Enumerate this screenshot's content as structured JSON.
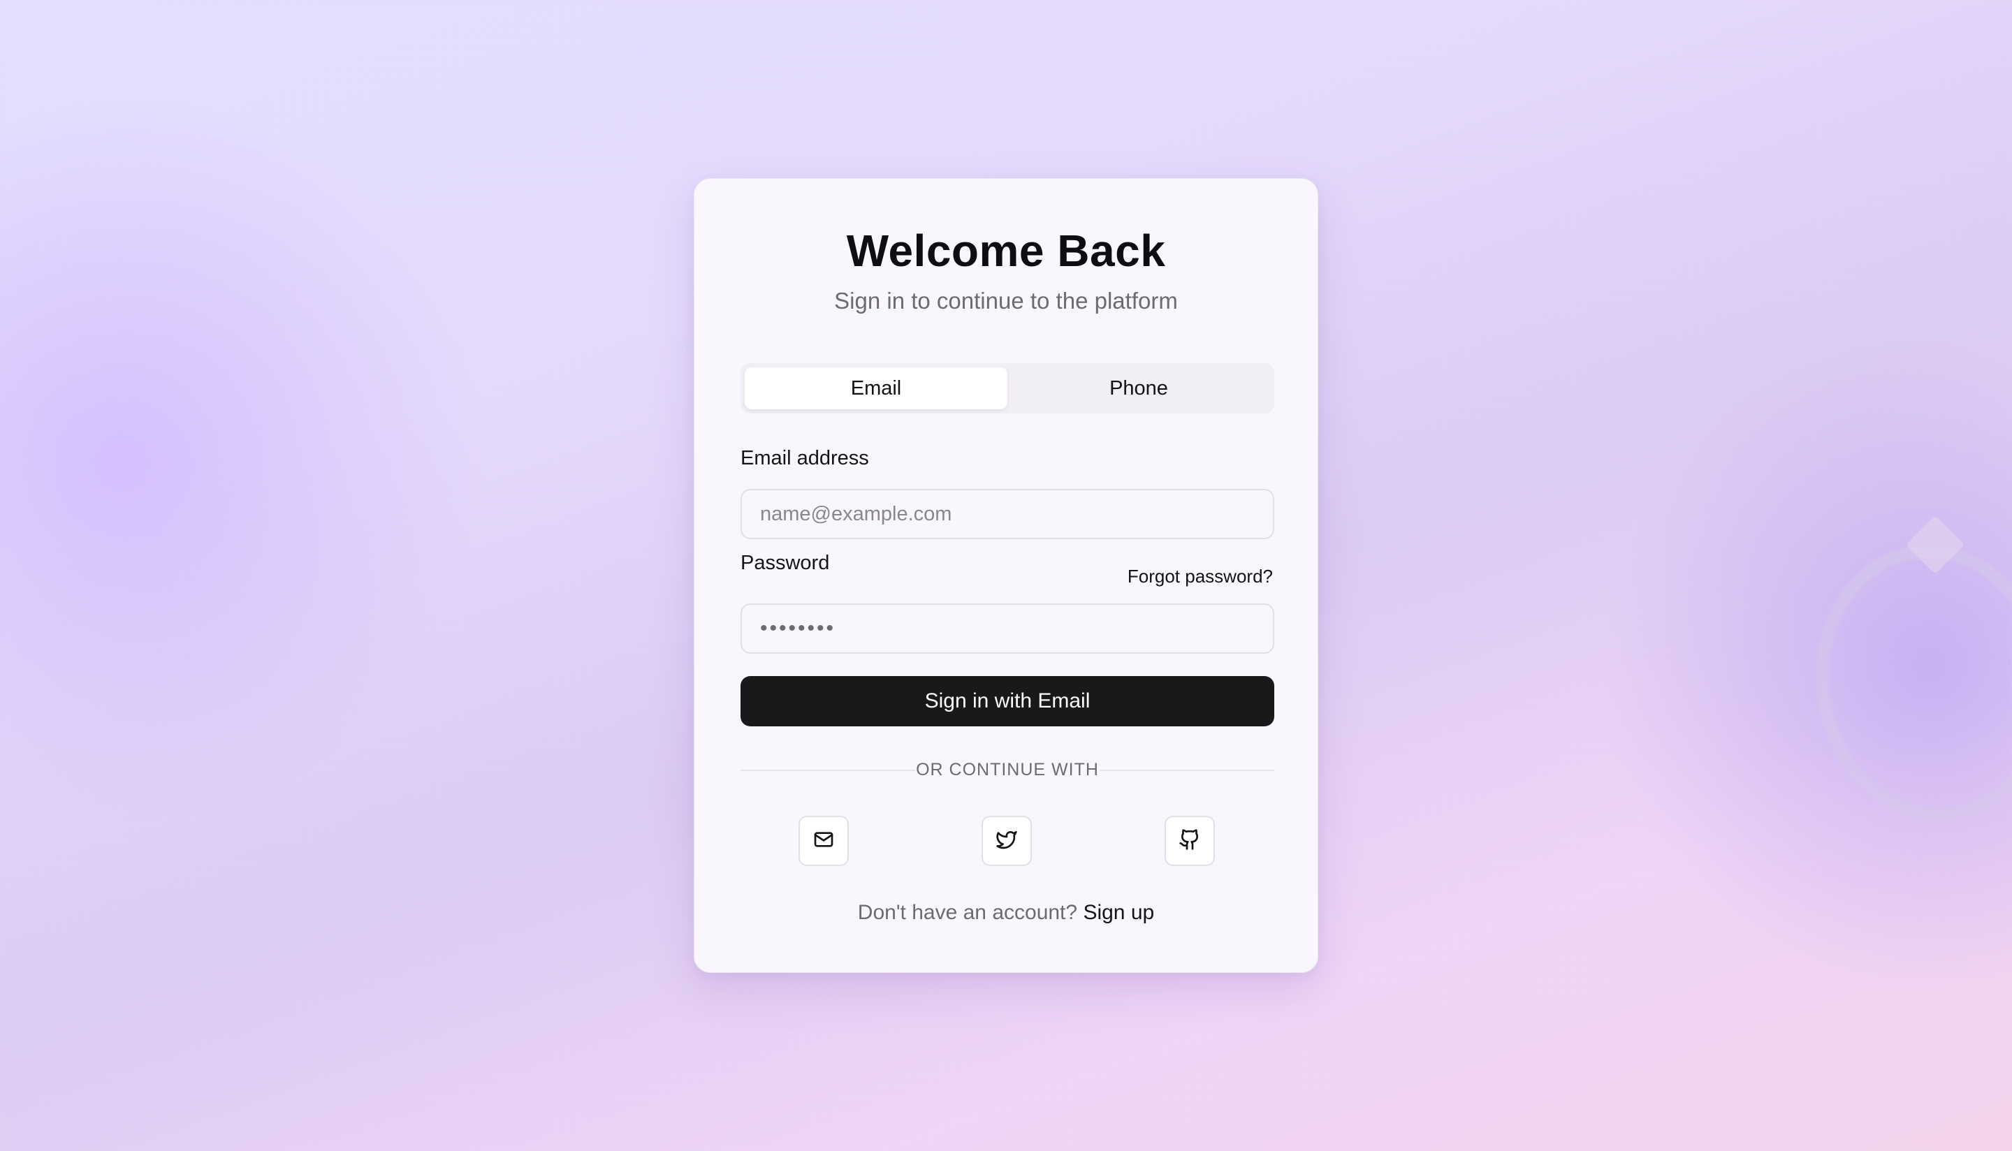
{
  "header": {
    "title": "Welcome Back",
    "subtitle": "Sign in to continue to the platform"
  },
  "tabs": [
    {
      "label": "Email",
      "active": true
    },
    {
      "label": "Phone",
      "active": false
    }
  ],
  "form": {
    "email_label": "Email address",
    "email_placeholder": "name@example.com",
    "password_label": "Password",
    "forgot_link": "Forgot password?",
    "password_mask": "••••••••",
    "submit_label": "Sign in with Email"
  },
  "divider": {
    "text": "OR CONTINUE WITH"
  },
  "social": [
    {
      "icon": "mail-icon"
    },
    {
      "icon": "twitter-icon"
    },
    {
      "icon": "github-icon"
    }
  ],
  "footer": {
    "prompt": "Don't have an account?",
    "signup_link": "Sign up"
  },
  "colors": {
    "primary_button": "#19191b",
    "text_primary": "#0e0e12",
    "text_muted": "#6d6a72"
  }
}
